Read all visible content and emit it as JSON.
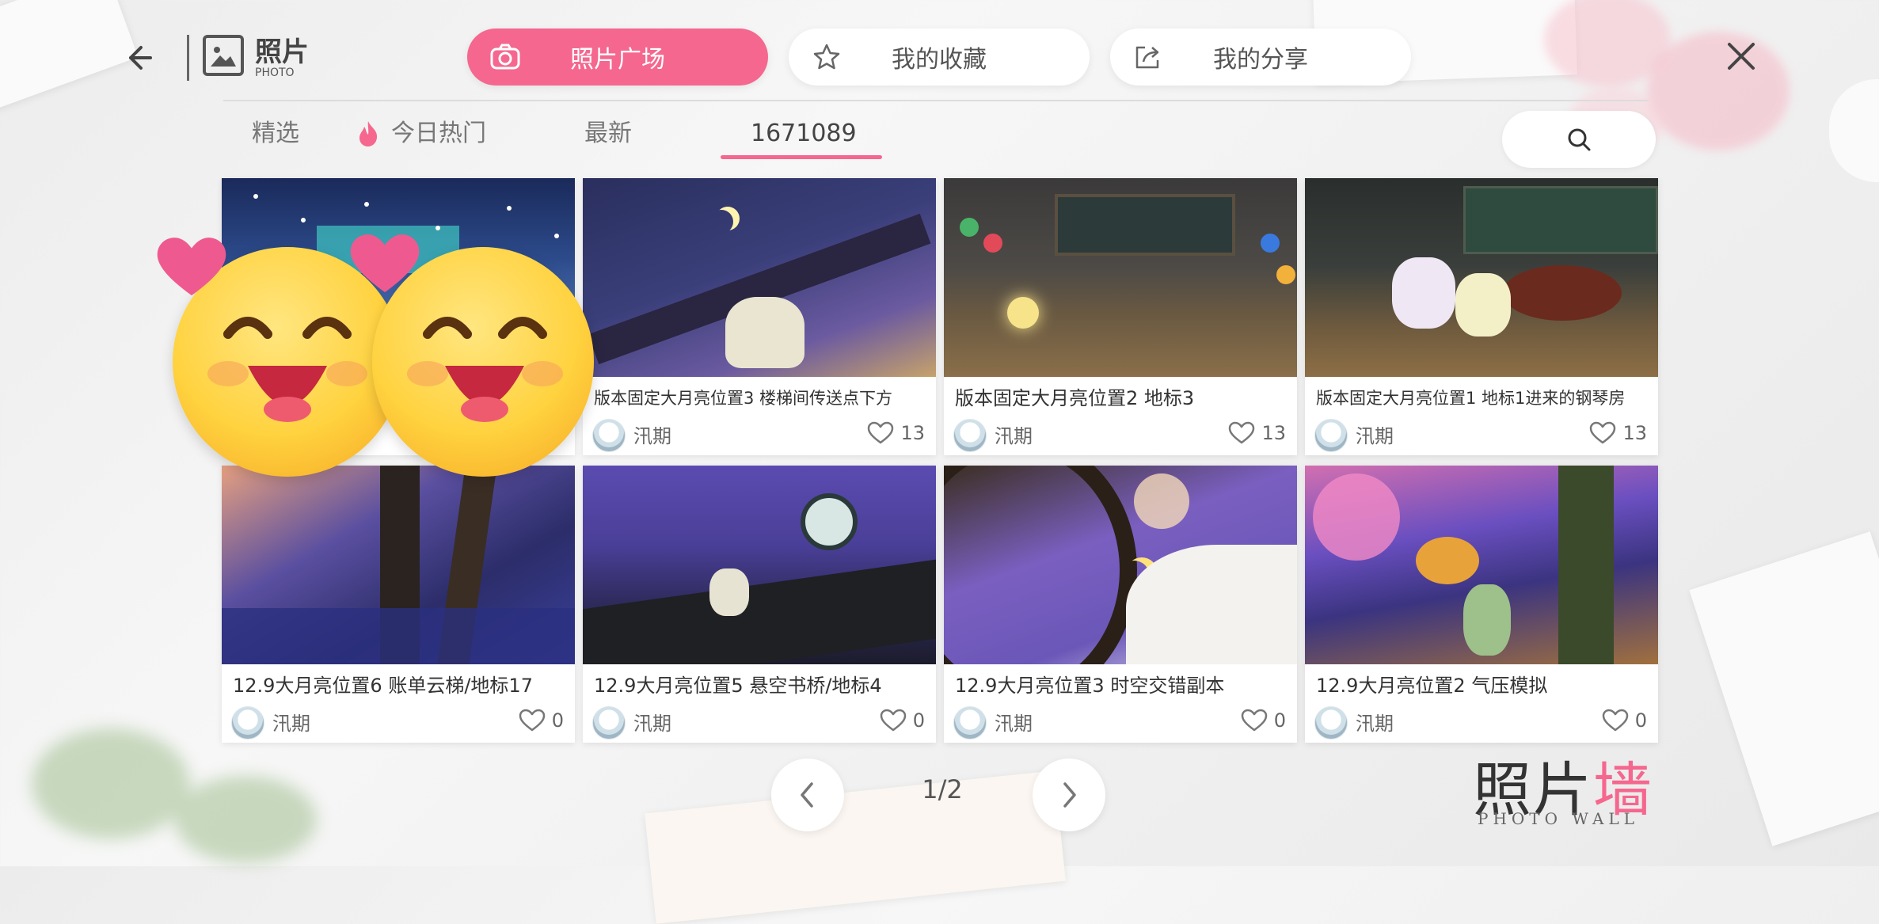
{
  "header": {
    "title": "照片",
    "subtitle": "PHOTO",
    "tabs": [
      {
        "label": "照片广场",
        "icon": "camera-icon",
        "active": true
      },
      {
        "label": "我的收藏",
        "icon": "star-icon",
        "active": false
      },
      {
        "label": "我的分享",
        "icon": "share-icon",
        "active": false
      }
    ]
  },
  "subtabs": [
    {
      "label": "精选"
    },
    {
      "label": "今日热门",
      "icon": "flame-icon"
    },
    {
      "label": "最新"
    },
    {
      "label": "1671089",
      "active": true
    }
  ],
  "search": {
    "icon": "search-icon"
  },
  "cards": [
    {
      "caption": "",
      "author": "",
      "likes": ""
    },
    {
      "caption": "版本固定大月亮位置3 楼梯间传送点下方",
      "author": "汛期",
      "likes": "13"
    },
    {
      "caption": "版本固定大月亮位置2 地标3",
      "author": "汛期",
      "likes": "13"
    },
    {
      "caption": "版本固定大月亮位置1 地标1进来的钢琴房",
      "author": "汛期",
      "likes": "13"
    },
    {
      "caption": "12.9大月亮位置6 账单云梯/地标17",
      "author": "汛期",
      "likes": "0"
    },
    {
      "caption": "12.9大月亮位置5 悬空书桥/地标4",
      "author": "汛期",
      "likes": "0"
    },
    {
      "caption": "12.9大月亮位置3 时空交错副本",
      "author": "汛期",
      "likes": "0"
    },
    {
      "caption": "12.9大月亮位置2 气压模拟",
      "author": "汛期",
      "likes": "0"
    }
  ],
  "pagination": {
    "indicator": "1/2"
  },
  "watermark": {
    "main_a": "照片",
    "main_b": "墙",
    "sub": "PHOTO WALL"
  },
  "colors": {
    "accent": "#f5678e"
  }
}
